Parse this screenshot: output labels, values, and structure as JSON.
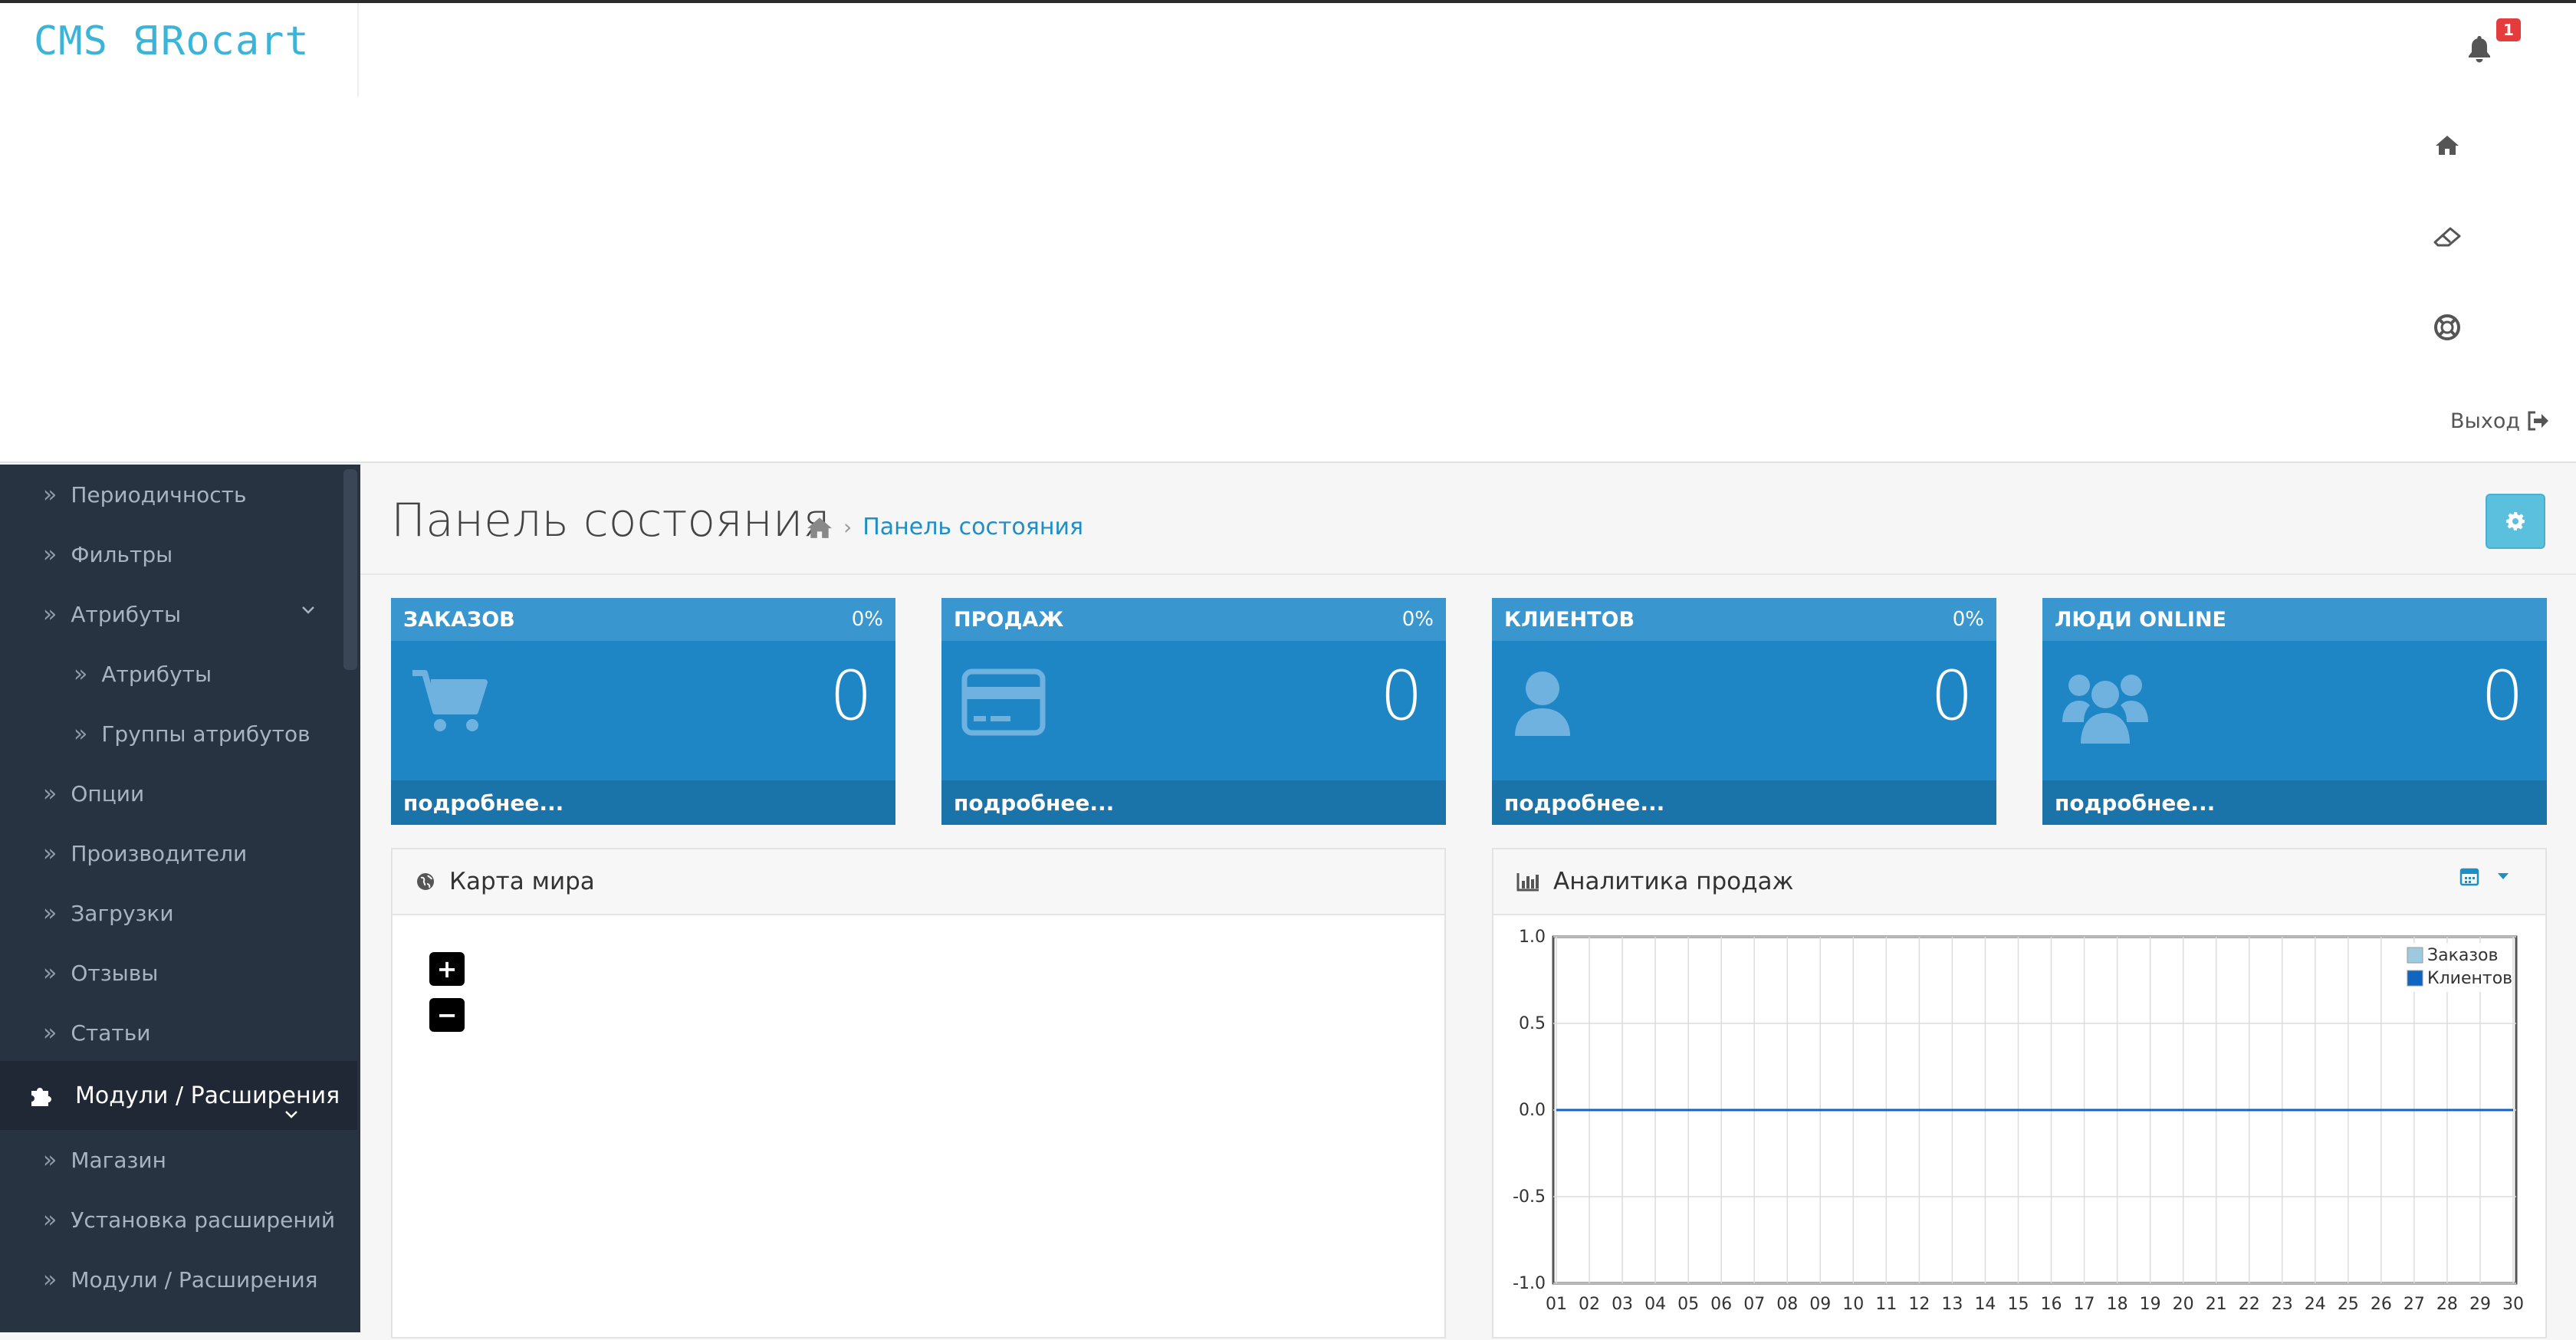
{
  "brand": {
    "logo_text": "CMS ꓭRocart",
    "accent": "#3cb4d8"
  },
  "topnav": {
    "notification_count": "1",
    "logout_label": "Выход",
    "icons": [
      "bell-icon",
      "home-icon",
      "eraser-icon",
      "life-ring-icon",
      "sign-out-icon"
    ]
  },
  "sidebar": {
    "items": [
      {
        "label": "Периодичность",
        "level": 1
      },
      {
        "label": "Фильтры",
        "level": 1
      },
      {
        "label": "Атрибуты",
        "level": 1,
        "expandable": true
      },
      {
        "label": "Атрибуты",
        "level": 2
      },
      {
        "label": "Группы атрибутов",
        "level": 2
      },
      {
        "label": "Опции",
        "level": 1
      },
      {
        "label": "Производители",
        "level": 1
      },
      {
        "label": "Загрузки",
        "level": 1
      },
      {
        "label": "Отзывы",
        "level": 1
      },
      {
        "label": "Статьи",
        "level": 1
      }
    ],
    "section": {
      "label": "Модули / Расширения",
      "icon": "puzzle-icon"
    },
    "section_items": [
      {
        "label": "Магазин"
      },
      {
        "label": "Установка расширений"
      },
      {
        "label": "Модули / Расширения"
      }
    ]
  },
  "page": {
    "title": "Панель состояния",
    "breadcrumb": "Панель состояния"
  },
  "tiles": [
    {
      "title": "ЗАКАЗОВ",
      "percent": "0%",
      "value": "0",
      "link": "подробнее...",
      "icon": "shopping-cart-icon"
    },
    {
      "title": "ПРОДАЖ",
      "percent": "0%",
      "value": "0",
      "link": "подробнее...",
      "icon": "credit-card-icon"
    },
    {
      "title": "КЛИЕНТОВ",
      "percent": "0%",
      "value": "0",
      "link": "подробнее...",
      "icon": "user-icon"
    },
    {
      "title": "ЛЮДИ ONLINE",
      "percent": "",
      "value": "0",
      "link": "подробнее...",
      "icon": "users-icon"
    }
  ],
  "map_panel": {
    "title": "Карта мира",
    "zoom_in": "+",
    "zoom_out": "−"
  },
  "analytics_panel": {
    "title": "Аналитика продаж"
  },
  "chart_data": {
    "type": "line",
    "title": "",
    "xlabel": "",
    "ylabel": "",
    "x": [
      "01",
      "02",
      "03",
      "04",
      "05",
      "06",
      "07",
      "08",
      "09",
      "10",
      "11",
      "12",
      "13",
      "14",
      "15",
      "16",
      "17",
      "18",
      "19",
      "20",
      "21",
      "22",
      "23",
      "24",
      "25",
      "26",
      "27",
      "28",
      "29",
      "30"
    ],
    "series": [
      {
        "name": "Заказов",
        "color": "#9ecae1",
        "values": [
          0,
          0,
          0,
          0,
          0,
          0,
          0,
          0,
          0,
          0,
          0,
          0,
          0,
          0,
          0,
          0,
          0,
          0,
          0,
          0,
          0,
          0,
          0,
          0,
          0,
          0,
          0,
          0,
          0,
          0
        ]
      },
      {
        "name": "Клиентов",
        "color": "#1065c0",
        "values": [
          0,
          0,
          0,
          0,
          0,
          0,
          0,
          0,
          0,
          0,
          0,
          0,
          0,
          0,
          0,
          0,
          0,
          0,
          0,
          0,
          0,
          0,
          0,
          0,
          0,
          0,
          0,
          0,
          0,
          0
        ]
      }
    ],
    "yticks": [
      "1.0",
      "0.5",
      "0.0",
      "-0.5",
      "-1.0"
    ],
    "ylim": [
      -1,
      1
    ],
    "grid": true,
    "legend": "top-right"
  }
}
